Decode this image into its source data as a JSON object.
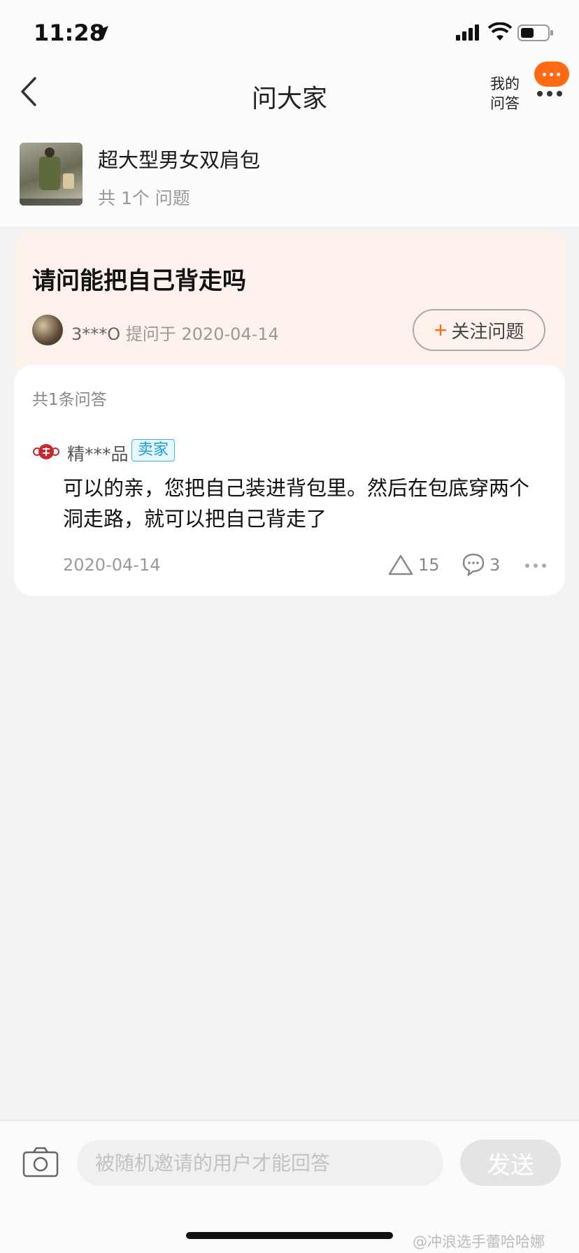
{
  "status_bar": {
    "time": "11:28"
  },
  "nav": {
    "title": "问大家",
    "my_qa": "我的问答"
  },
  "product": {
    "title": "超大型男女双肩包",
    "question_count": "共 1个 问题"
  },
  "question": {
    "title": "请问能把自己背走吗",
    "asker": "3***O",
    "asked_label": "提问于 2020-04-14",
    "follow_label": "关注问题"
  },
  "answers": {
    "count_label": "共1条问答",
    "items": [
      {
        "author": "精***品",
        "badge": "卖家",
        "text": "可以的亲，您把自己装进背包里。然后在包底穿两个洞走路，就可以把自己背走了",
        "date": "2020-04-14",
        "likes": "15",
        "comments": "3"
      }
    ]
  },
  "bottom_bar": {
    "input_placeholder": "被随机邀请的用户才能回答",
    "send_label": "发送"
  },
  "watermark": "@冲浪选手蕾哈哈娜",
  "colors": {
    "accent": "#ff6a13",
    "badge_blue": "#1a9fdc",
    "question_bg": "#fdf1ec"
  }
}
